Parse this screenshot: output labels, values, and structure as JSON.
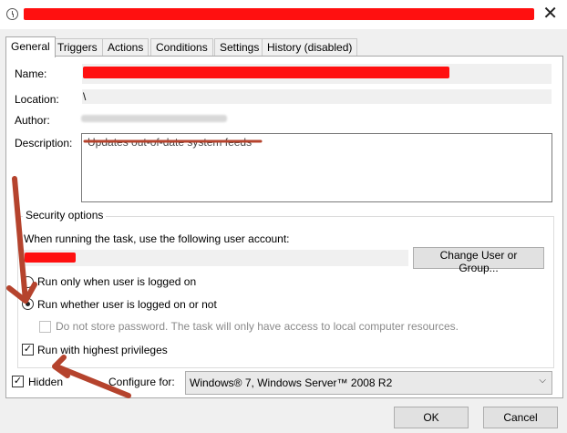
{
  "window": {
    "title_redacted": true,
    "close_glyph": "✕"
  },
  "tabs": [
    {
      "label": "General"
    },
    {
      "label": "Triggers"
    },
    {
      "label": "Actions"
    },
    {
      "label": "Conditions"
    },
    {
      "label": "Settings"
    },
    {
      "label": "History (disabled)"
    }
  ],
  "general": {
    "name_label": "Name:",
    "location_label": "Location:",
    "location_value": "\\",
    "author_label": "Author:",
    "description_label": "Description:",
    "description_value": "Updates out-of-date system feeds"
  },
  "security": {
    "group_label": "Security options",
    "account_prompt": "When running the task, use the following user account:",
    "change_user_button": "Change User or Group...",
    "radio_logged_on": "Run only when user is logged on",
    "radio_whether": "Run whether user is logged on or not",
    "do_not_store": "Do not store password.  The task will only have access to local computer resources.",
    "highest_privileges": "Run with highest privileges"
  },
  "footer": {
    "hidden_label": "Hidden",
    "configure_label": "Configure for:",
    "configure_value": "Windows® 7, Windows Server™ 2008 R2",
    "ok_button": "OK",
    "cancel_button": "Cancel"
  },
  "state": {
    "radio_selected": "run_whether",
    "highest_privileges_checked": true,
    "hidden_checked": true,
    "do_not_store_checked": false,
    "do_not_store_enabled": false
  },
  "colors": {
    "redaction": "#ff1010",
    "annotation_arrow": "#b5432d"
  }
}
